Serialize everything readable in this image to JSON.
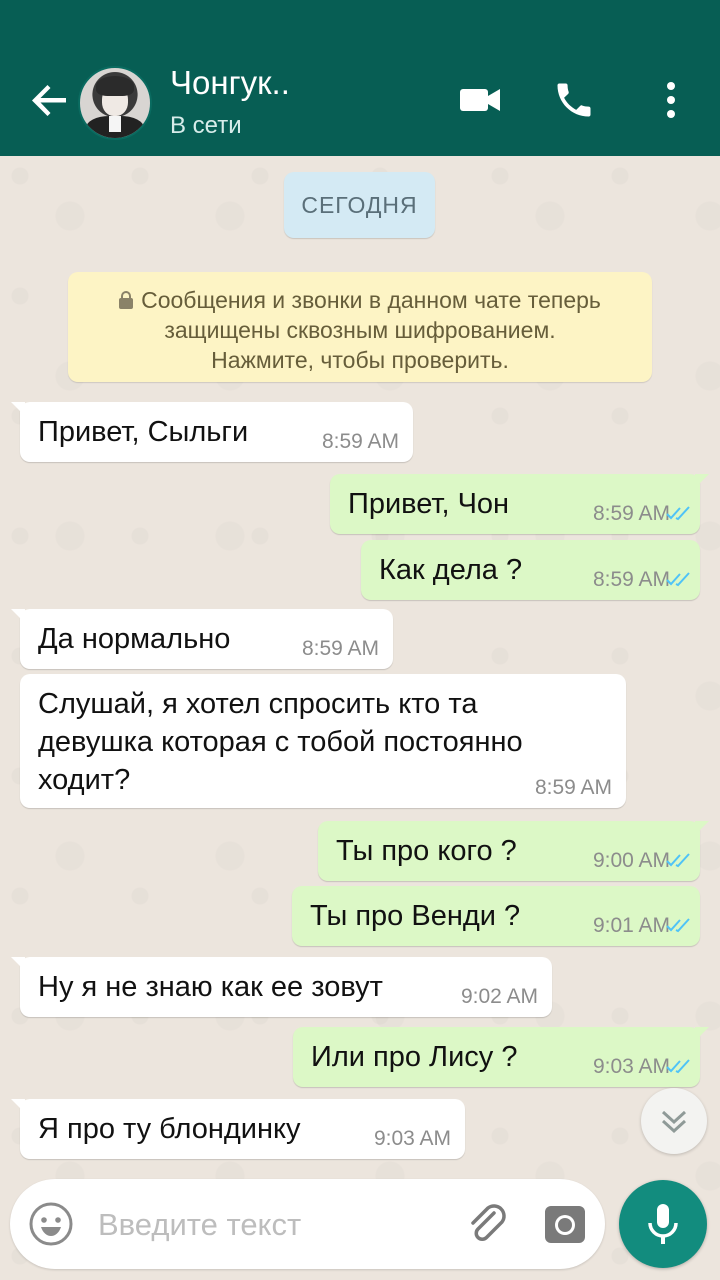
{
  "header": {
    "contact_name": "Чонгук..",
    "status": "В сети",
    "avatar": "avatar-photo",
    "icons": [
      "back-arrow-icon",
      "video-call-icon",
      "phone-icon",
      "more-vert-icon"
    ]
  },
  "chat": {
    "date_chip": "СЕГОДНЯ",
    "encryption_notice": {
      "line1": "Сообщения и звонки в данном чате теперь",
      "line2": "защищены сквозным шифрованием.",
      "line3": "Нажмите, чтобы проверить."
    },
    "messages": [
      {
        "dir": "in",
        "lines": [
          "Привет, Сыльги"
        ],
        "time": "8:59 AM"
      },
      {
        "dir": "out",
        "lines": [
          "Привет, Чон"
        ],
        "time": "8:59 AM",
        "read": true
      },
      {
        "dir": "out",
        "lines": [
          "Как дела ?"
        ],
        "time": "8:59 AM",
        "read": true
      },
      {
        "dir": "in",
        "lines": [
          "Да нормально"
        ],
        "time": "8:59 AM"
      },
      {
        "dir": "in",
        "lines": [
          "Слушай, я хотел спросить кто та",
          "девушка которая с тобой постоянно",
          "ходит?"
        ],
        "time": "8:59 AM"
      },
      {
        "dir": "out",
        "lines": [
          "Ты про кого ?"
        ],
        "time": "9:00 AM",
        "read": true
      },
      {
        "dir": "out",
        "lines": [
          "Ты про Венди ?"
        ],
        "time": "9:01 AM",
        "read": true
      },
      {
        "dir": "in",
        "lines": [
          "Ну я не знаю как ее зовут"
        ],
        "time": "9:02 AM"
      },
      {
        "dir": "out",
        "lines": [
          "Или про Лису ?"
        ],
        "time": "9:03 AM",
        "read": true
      },
      {
        "dir": "in",
        "lines": [
          "Я про ту блондинку"
        ],
        "time": "9:03 AM"
      }
    ]
  },
  "input": {
    "placeholder": "Введите текст",
    "value": ""
  },
  "colors": {
    "header": "#075e54",
    "outgoing_bubble": "#dcf8c6",
    "incoming_bubble": "#ffffff",
    "read_ticks": "#4fc3f7",
    "mic_button": "#128c7e"
  }
}
